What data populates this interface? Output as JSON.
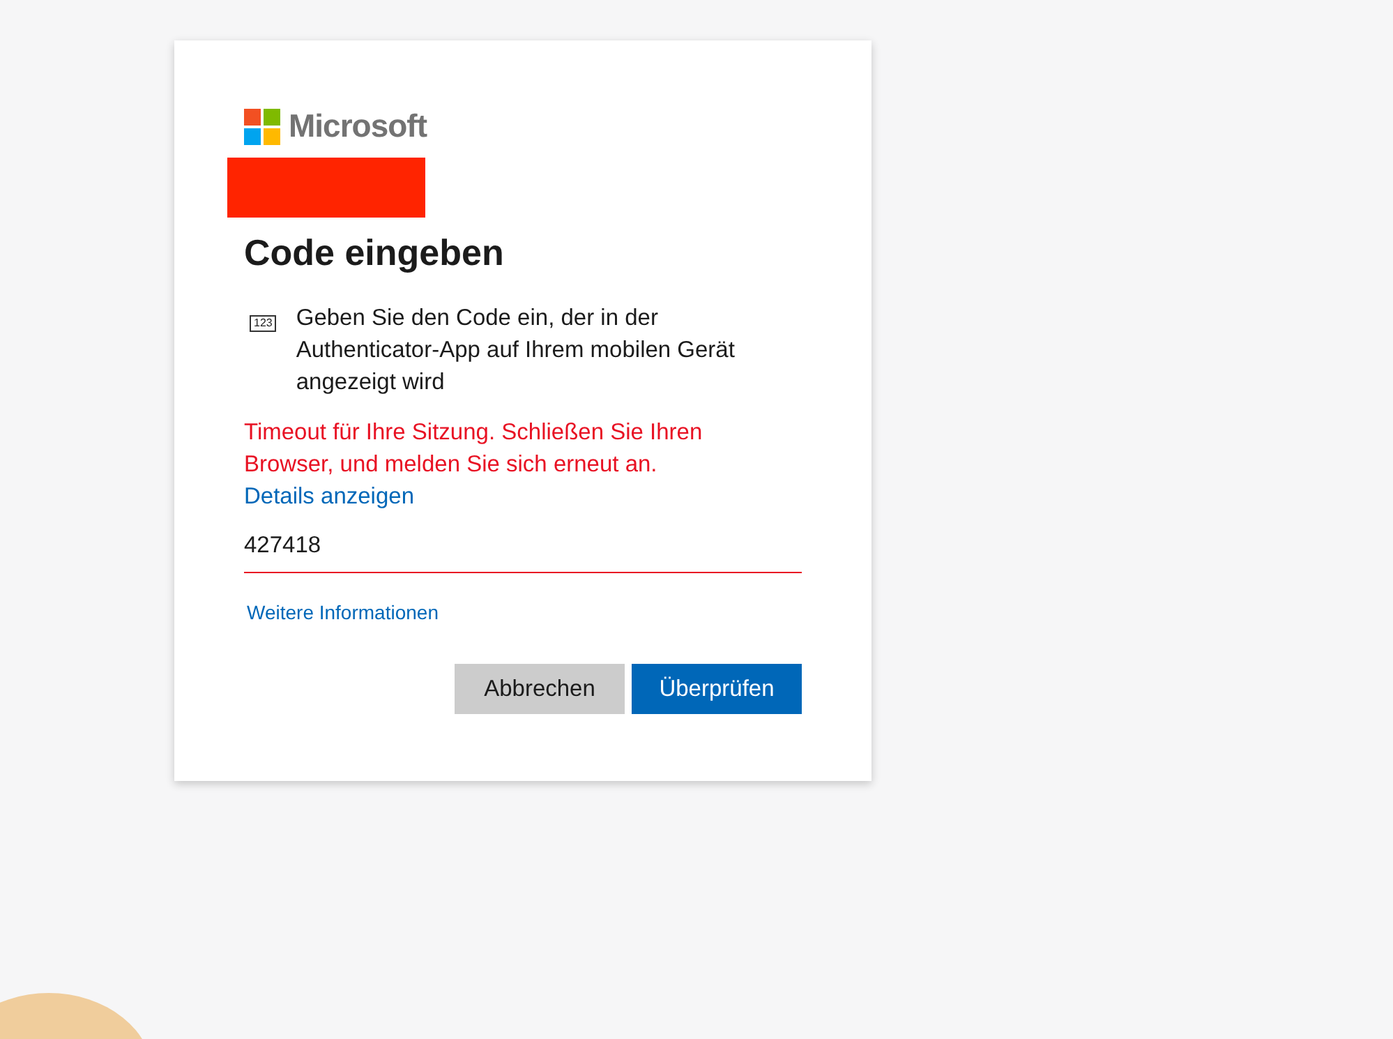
{
  "logo": {
    "text": "Microsoft"
  },
  "title": "Code eingeben",
  "instruction": {
    "icon_text": "123",
    "text": "Geben Sie den Code ein, der in der Authenticator-App auf Ihrem mobilen Gerät angezeigt wird"
  },
  "error": {
    "text": "Timeout für Ihre Sitzung. Schließen Sie Ihren Browser, und melden Sie sich erneut an.",
    "link": "Details anzeigen"
  },
  "code_field": {
    "value": "427418",
    "invalid": true
  },
  "more_info_link": "Weitere Informationen",
  "buttons": [
    {
      "label": "Abbrechen",
      "kind": "secondary"
    },
    {
      "label": "Überprüfen",
      "kind": "primary"
    }
  ]
}
